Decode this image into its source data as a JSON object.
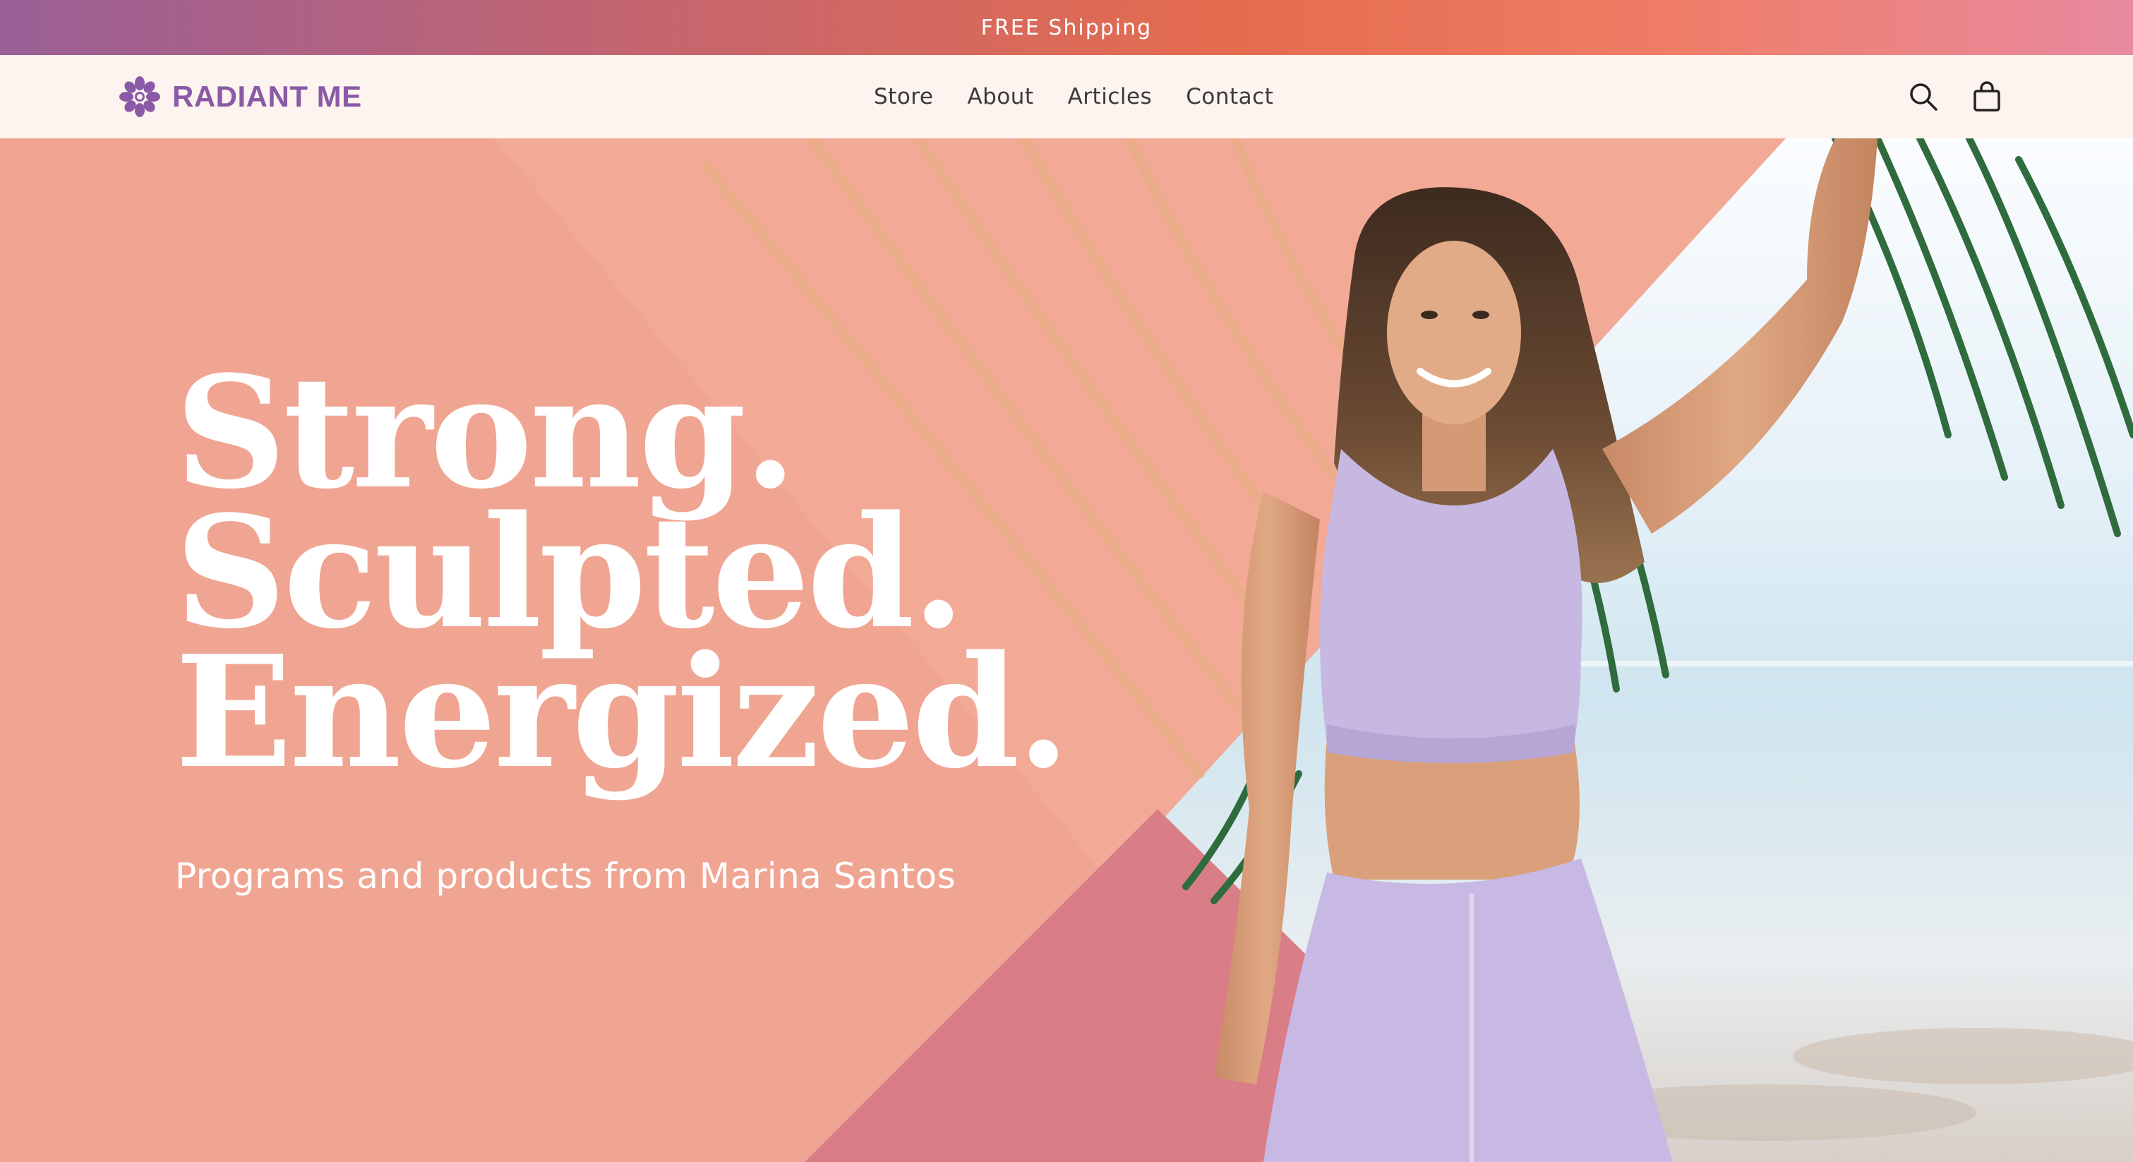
{
  "announcement": {
    "text": "FREE Shipping"
  },
  "header": {
    "logo_text": "RADIANT ME",
    "nav": [
      {
        "label": "Store"
      },
      {
        "label": "About"
      },
      {
        "label": "Articles"
      },
      {
        "label": "Contact"
      }
    ],
    "icons": {
      "search": "search-icon",
      "cart": "cart-icon"
    }
  },
  "hero": {
    "headline_lines": [
      "Strong.",
      "Sculpted.",
      "Energized."
    ],
    "subtitle": "Programs and products from Marina Santos"
  },
  "colors": {
    "brand_purple": "#8a5aa6",
    "hero_peach": "#f0a592",
    "hero_rose": "#d97d86",
    "header_bg": "#fdf3ef"
  }
}
